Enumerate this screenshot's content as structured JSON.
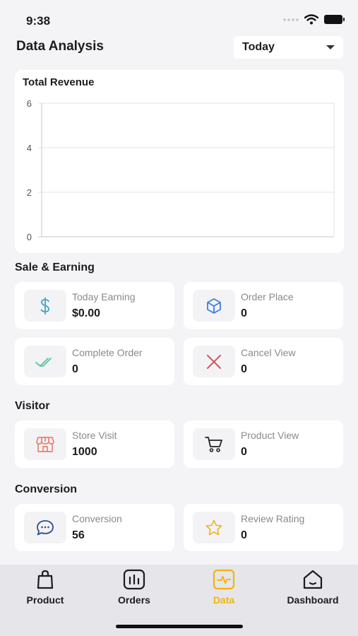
{
  "status": {
    "time": "9:38"
  },
  "header": {
    "title": "Data Analysis",
    "period": "Today"
  },
  "revenue": {
    "title": "Total Revenue",
    "chart_data": {
      "type": "line",
      "title": "Total Revenue",
      "xlabel": "",
      "ylabel": "",
      "ylim": [
        0,
        6
      ],
      "y_ticks": [
        "0",
        "2",
        "4",
        "6"
      ],
      "series": [],
      "grid": true
    }
  },
  "sales": {
    "title": "Sale & Earning",
    "today_earning": {
      "label": "Today Earning",
      "value": "$0.00",
      "icon": "dollar-icon"
    },
    "order_place": {
      "label": "Order Place",
      "value": "0",
      "icon": "box-icon"
    },
    "complete_order": {
      "label": "Complete Order",
      "value": "0",
      "icon": "double-check-icon"
    },
    "cancel_view": {
      "label": "Cancel View",
      "value": "0",
      "icon": "close-icon"
    }
  },
  "visitor": {
    "title": "Visitor",
    "store_visit": {
      "label": "Store Visit",
      "value": "1000",
      "icon": "store-icon"
    },
    "product_view": {
      "label": "Product View",
      "value": "0",
      "icon": "cart-icon"
    }
  },
  "conversion": {
    "title": "Conversion",
    "conversion": {
      "label": "Conversion",
      "value": "56",
      "icon": "chat-icon"
    },
    "review_rating": {
      "label": "Review Rating",
      "value": "0",
      "icon": "star-icon"
    }
  },
  "tabs": [
    {
      "label": "Product",
      "icon": "bag-icon"
    },
    {
      "label": "Orders",
      "icon": "orders-icon"
    },
    {
      "label": "Data",
      "icon": "activity-icon",
      "active": true
    },
    {
      "label": "Dashboard",
      "icon": "home-icon"
    }
  ],
  "colors": {
    "accent": "#f5b40a",
    "blue": "#3f7fd8",
    "green": "#5fc0a8",
    "red": "#d05563",
    "orange": "#e8826a"
  }
}
